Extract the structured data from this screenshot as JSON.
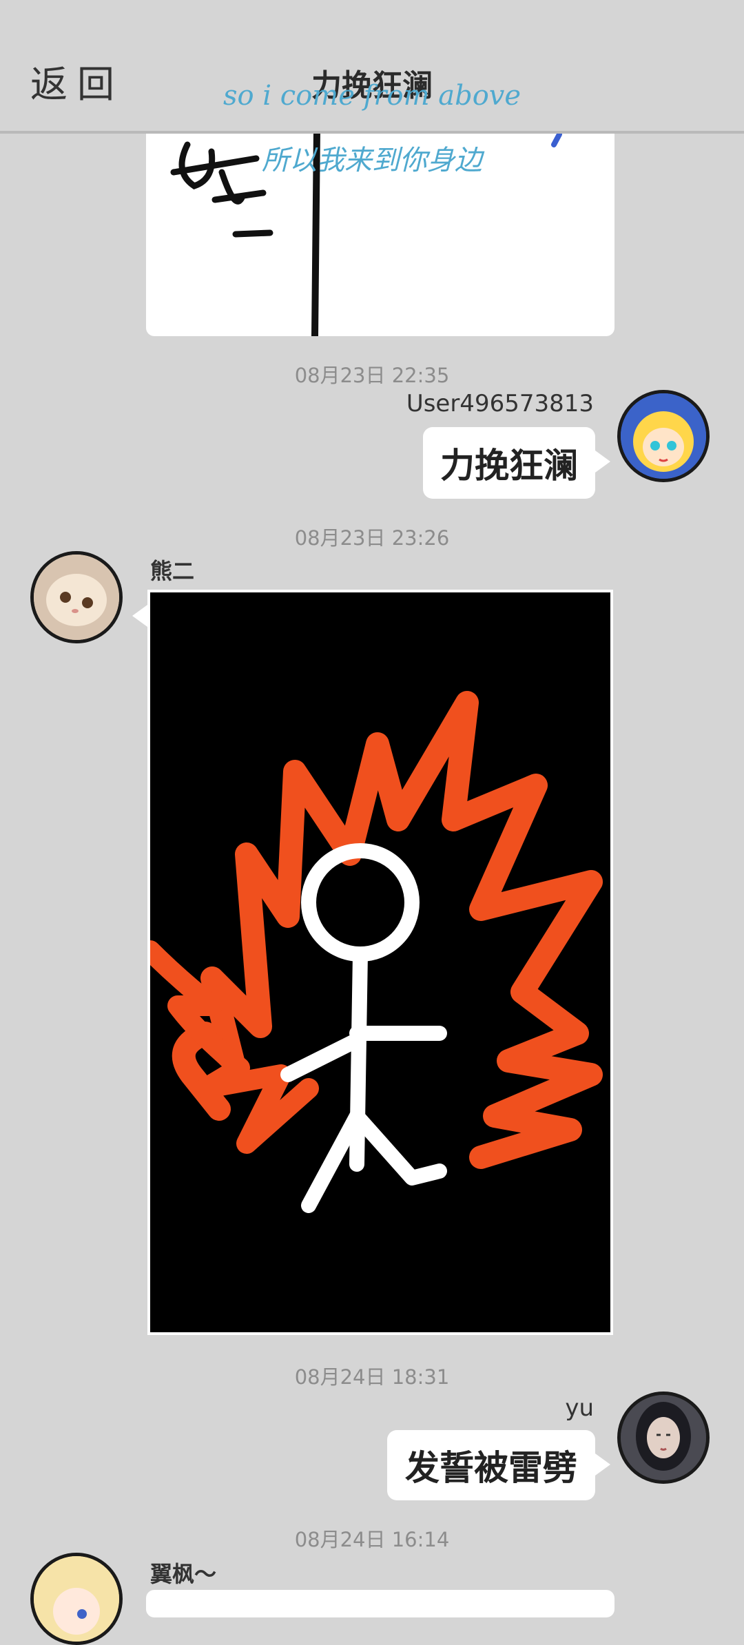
{
  "header": {
    "back_label": "返回",
    "title": "力挽狂澜"
  },
  "overlays": {
    "english_line": "so i come from above",
    "chinese_line": "所以我来到你身边"
  },
  "messages": [
    {
      "type": "image-partial",
      "side": "left",
      "description_icon": "handwritten-chars-image"
    },
    {
      "type": "text",
      "time": "08月23日  22:35",
      "side": "right",
      "sender": "User496573813",
      "text": "力挽狂澜",
      "avatar": "anime-girl-blue-avatar"
    },
    {
      "type": "image",
      "time": "08月23日  23:26",
      "side": "left",
      "sender": "熊二",
      "avatar": "cat-avatar",
      "image_icon": "stick-figure-flames-image"
    },
    {
      "type": "text",
      "time": "08月24日  18:31",
      "side": "right",
      "sender": "yu",
      "text": "发誓被雷劈",
      "avatar": "dark-hair-woman-avatar"
    },
    {
      "type": "image-partial",
      "time": "08月24日  16:14",
      "side": "left",
      "sender": "翼枫～",
      "avatar": "blonde-anime-avatar"
    }
  ],
  "colors": {
    "background": "#d5d5d5",
    "overlay_text": "#4fa9cf",
    "flame": "#f0501e"
  }
}
